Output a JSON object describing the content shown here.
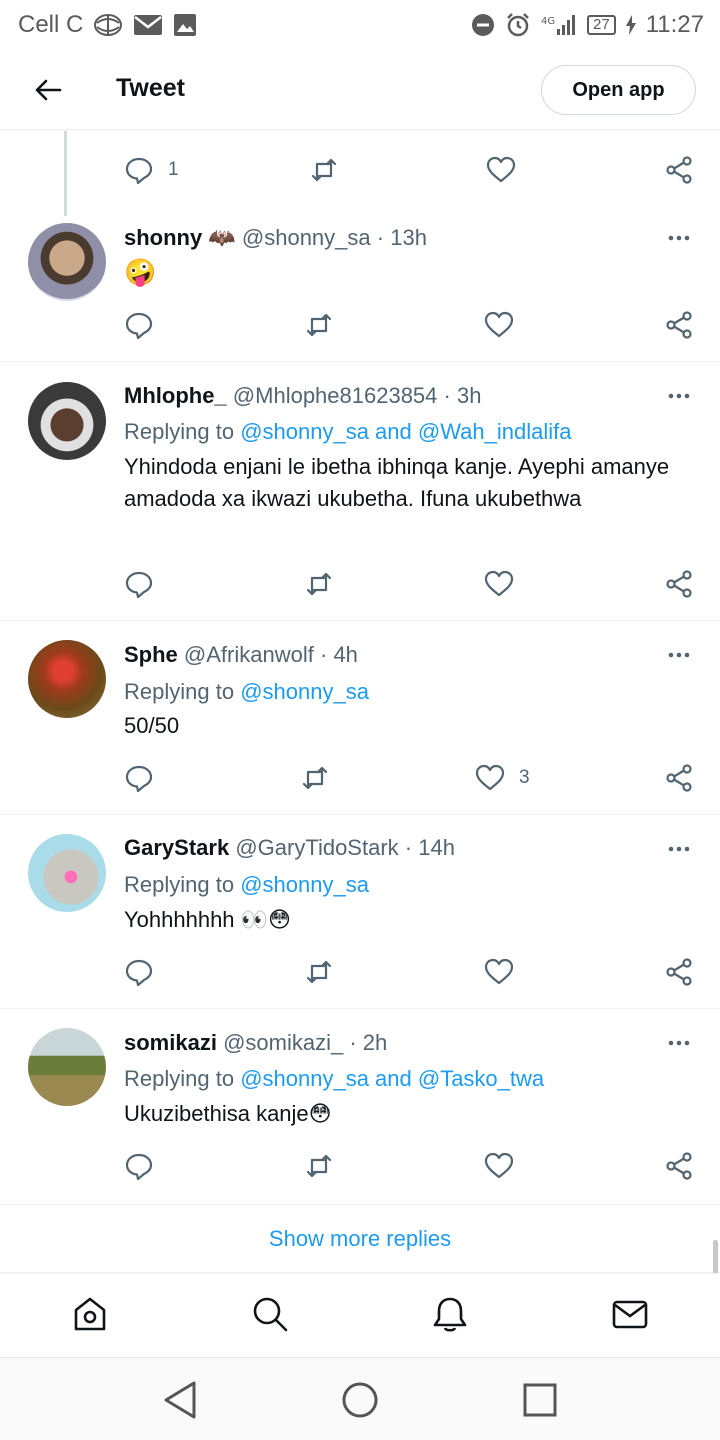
{
  "status_bar": {
    "carrier": "Cell C",
    "network": "4G",
    "battery": "27",
    "time": "11:27"
  },
  "header": {
    "title": "Tweet",
    "open_app_label": "Open app",
    "back_icon": "arrow-left-icon"
  },
  "top_actions": {
    "reply_count": "1"
  },
  "replies": [
    {
      "name": "shonny",
      "name_emoji": "🦇",
      "handle": "@shonny_sa",
      "time": "13h",
      "replying_prefix": "",
      "mentions": "",
      "text": "🤪",
      "reply_count": "",
      "like_count": ""
    },
    {
      "name": "Mhlophe_",
      "handle": "@Mhlophe81623854",
      "time": "3h",
      "replying_prefix": "Replying to ",
      "mentions": "@shonny_sa and @Wah_indlalifa",
      "text": "Yhindoda enjani le  ibetha ibhinqa kanje. Ayephi amanye amadoda xa ikwazi ukubetha. Ifuna ukubethwa",
      "reply_count": "",
      "like_count": ""
    },
    {
      "name": "Sphe",
      "handle": "@Afrikanwolf",
      "time": "4h",
      "replying_prefix": "Replying to ",
      "mentions": "@shonny_sa",
      "text": "50/50",
      "reply_count": "",
      "like_count": "3"
    },
    {
      "name": "GaryStark",
      "handle": "@GaryTidoStark",
      "time": "14h",
      "replying_prefix": "Replying to ",
      "mentions": "@shonny_sa",
      "text": "Yohhhhhhh 👀😳",
      "reply_count": "",
      "like_count": ""
    },
    {
      "name": "somikazi",
      "handle": "@somikazi_",
      "time": "2h",
      "replying_prefix": "Replying to ",
      "mentions": "@shonny_sa and @Tasko_twa",
      "text": "Ukuzibethisa kanje😳",
      "reply_count": "",
      "like_count": ""
    }
  ],
  "show_more_label": "Show more replies",
  "bottom_nav": [
    "home-icon",
    "search-icon",
    "notifications-icon",
    "messages-icon"
  ],
  "system_nav": [
    "back-triangle-icon",
    "home-circle-icon",
    "recents-square-icon"
  ],
  "colors": {
    "link": "#1d9bf0",
    "secondary_text": "#536471",
    "primary_text": "#0f1419"
  }
}
